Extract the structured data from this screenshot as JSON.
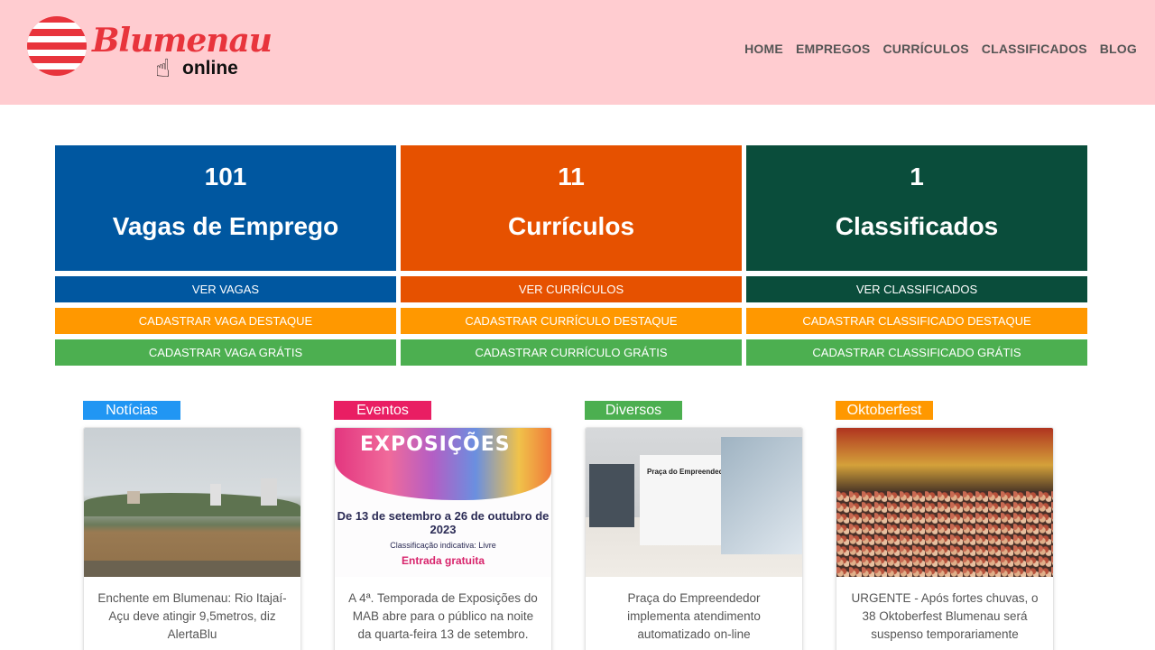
{
  "header": {
    "logo": {
      "word": "Blumenau",
      "sub": "online"
    },
    "nav": [
      "HOME",
      "EMPREGOS",
      "CURRÍCULOS",
      "CLASSIFICADOS",
      "BLOG"
    ]
  },
  "stats": [
    {
      "count": "101",
      "label": "Vagas de Emprego",
      "color": "#0057a0",
      "buttons": [
        "VER VAGAS",
        "CADASTRAR VAGA DESTAQUE",
        "CADASTRAR VAGA GRÁTIS"
      ]
    },
    {
      "count": "11",
      "label": "Currículos",
      "color": "#e65100",
      "buttons": [
        "VER CURRÍCULOS",
        "CADASTRAR CURRÍCULO DESTAQUE",
        "CADASTRAR CURRÍCULO GRÁTIS"
      ]
    },
    {
      "count": "1",
      "label": "Classificados",
      "color": "#0a4d3b",
      "buttons": [
        "VER CLASSIFICADOS",
        "CADASTRAR CLASSIFICADO DESTAQUE",
        "CADASTRAR CLASSIFICADO GRÁTIS"
      ]
    }
  ],
  "button_colors": {
    "highlight": "#ff9800",
    "free": "#4caf50"
  },
  "cards": [
    {
      "tag": "Notícias",
      "tag_color": "#2196f3",
      "caption": "Enchente em Blumenau: Rio Itajaí-Açu deve atingir 9,5metros, diz AlertaBlu"
    },
    {
      "tag": "Eventos",
      "tag_color": "#e91e63",
      "caption": "A 4ª. Temporada de Exposições do MAB abre para o público na noite da quarta-feira 13 de setembro.",
      "image_text": {
        "title": "EXPOSIÇÕES",
        "dates": "De 13 de setembro a 26 de outubro de 2023",
        "classification": "Classificação indicativa: Livre",
        "entry": "Entrada gratuita"
      }
    },
    {
      "tag": "Diversos",
      "tag_color": "#4caf50",
      "caption": "Praça do Empreendedor implementa atendimento automatizado on-line",
      "image_text": {
        "sign": "Praça do Empreendedor"
      }
    },
    {
      "tag": "Oktoberfest",
      "tag_color": "#ff9800",
      "caption": "URGENTE - Após fortes chuvas, o 38 Oktoberfest Blumenau será suspenso temporariamente"
    }
  ]
}
